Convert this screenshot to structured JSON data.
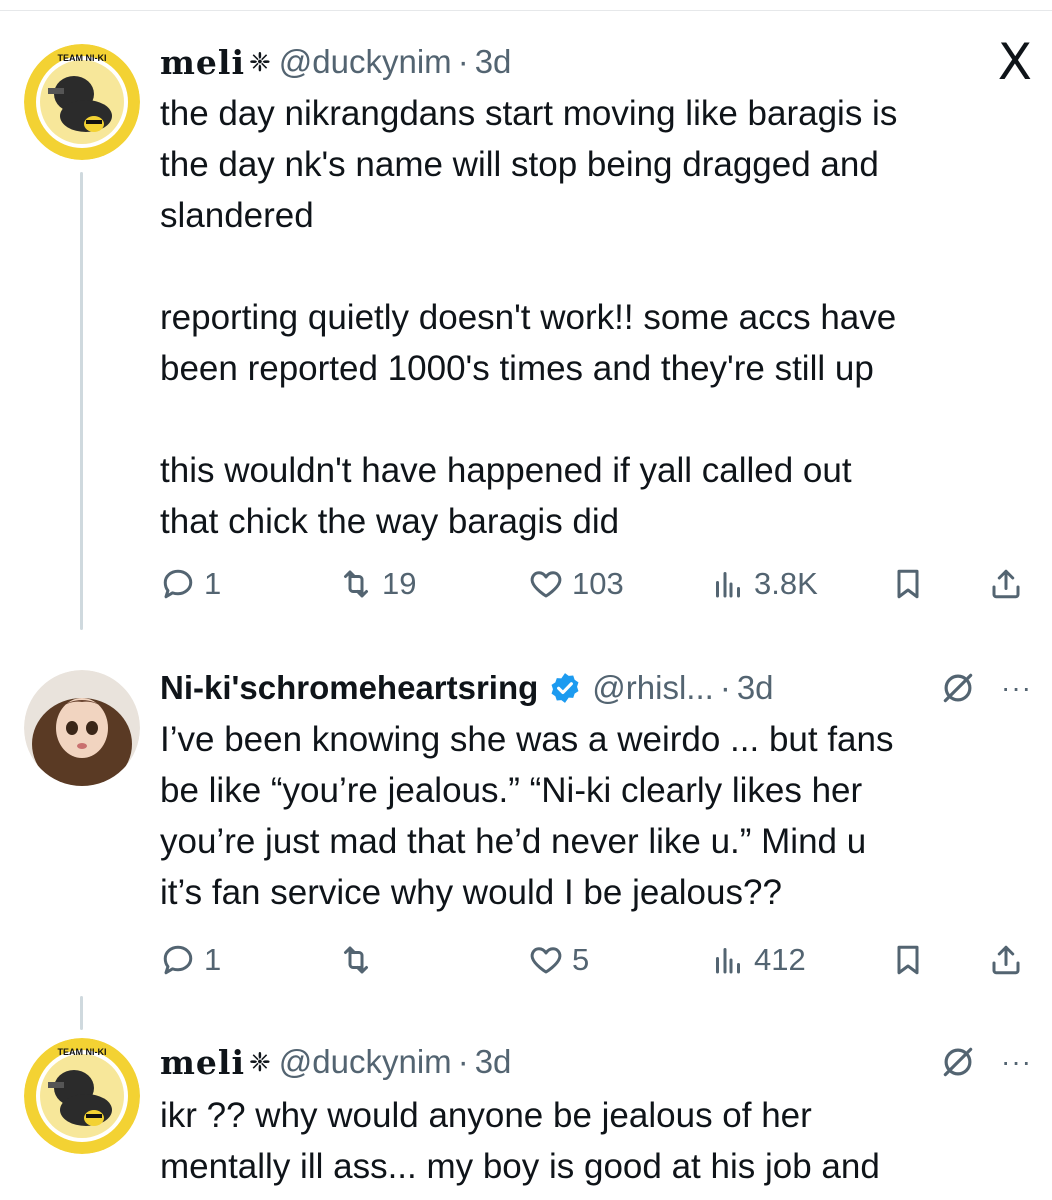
{
  "tweets": [
    {
      "name": "meli",
      "glyph": "❈",
      "handle": "@duckynim",
      "dot": "·",
      "time": "3d",
      "body": "the day nikrangdans start moving like baragis is\nthe day nk's name will stop being dragged and\nslandered\n\nreporting quietly doesn't work!! some accs have\nbeen reported 1000's times and they're still up\n\nthis wouldn't have happened if yall called out\nthat chick the way baragis did",
      "replies": "1",
      "retweets": "19",
      "likes": "103",
      "views": "3.8K",
      "avatar_text": "TEAM NI-KI"
    },
    {
      "name": "Ni-ki'schromeheartsring",
      "handle": "@rhisl...",
      "dot": "·",
      "time": "3d",
      "more": "···",
      "body": "I’ve been knowing she was a weirdo ... but fans\nbe like “you’re jealous.” “Ni-ki clearly likes her\nyou’re just mad that he’d never like u.” Mind u\nit’s fan service why would I be jealous??",
      "replies": "1",
      "retweets": "",
      "likes": "5",
      "views": "412"
    },
    {
      "name": "meli",
      "glyph": "❈",
      "handle": "@duckynim",
      "dot": "·",
      "time": "3d",
      "more": "···",
      "body": "ikr ?? why would anyone be jealous of her\nmentally ill ass... my boy is good at his job and",
      "avatar_text": "TEAM NI-KI"
    }
  ],
  "x_logo": "X",
  "colors": {
    "text": "#0f1419",
    "muted": "#536471",
    "verified": "#1d9bf0",
    "thread": "#cfd9de",
    "avatar_ring": "#f3d233"
  }
}
